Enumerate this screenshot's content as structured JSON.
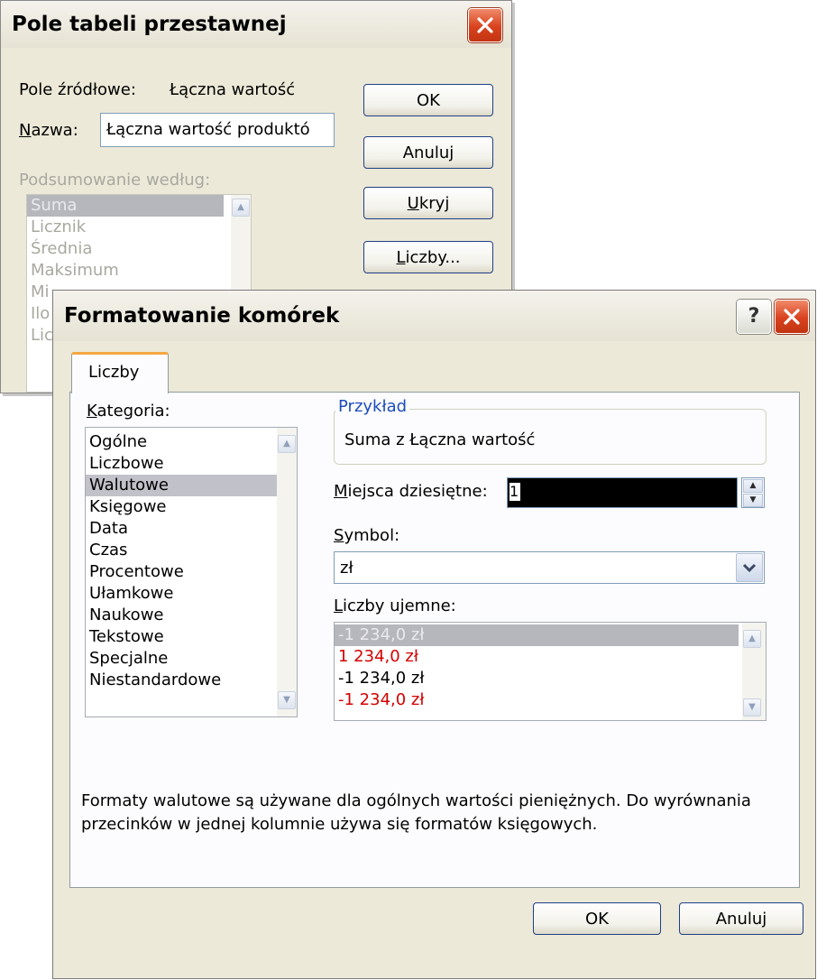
{
  "pivot_dialog": {
    "title": "Pole tabeli przestawnej",
    "source_field_label": "Pole źródłowe:",
    "source_field_value": "Łączna wartość",
    "name_label_u": "N",
    "name_label_rest": "azwa:",
    "name_value": "Łączna wartość produktó",
    "summary_label": "Podsumowanie według:",
    "summary_items": [
      "Suma",
      "Licznik",
      "Średnia",
      "Maksimum",
      "Mi",
      "Ilo",
      "Lic"
    ],
    "ok": "OK",
    "cancel": "Anuluj",
    "hide_u": "U",
    "hide_rest": "kryj",
    "numbers_u": "L",
    "numbers_rest": "iczby..."
  },
  "format_dialog": {
    "title": "Formatowanie komórek",
    "help_icon": "?",
    "tab": "Liczby",
    "category_label_u": "K",
    "category_label_rest": "ategoria:",
    "categories": [
      "Ogólne",
      "Liczbowe",
      "Walutowe",
      "Księgowe",
      "Data",
      "Czas",
      "Procentowe",
      "Ułamkowe",
      "Naukowe",
      "Tekstowe",
      "Specjalne",
      "Niestandardowe"
    ],
    "selected_category": "Walutowe",
    "sample_label": "Przykład",
    "sample_value": "Suma z Łączna wartość",
    "decimals_label_u": "M",
    "decimals_label_rest": "iejsca dziesiętne:",
    "decimals_value": "1",
    "symbol_label_u": "S",
    "symbol_label_rest": "ymbol:",
    "symbol_value": "zł",
    "negative_label_u": "L",
    "negative_label_rest": "iczby ujemne:",
    "negative_items": [
      {
        "text": "-1 234,0 zł",
        "style": "selected"
      },
      {
        "text": "1 234,0 zł",
        "style": "red"
      },
      {
        "text": "-1 234,0 zł",
        "style": "normal"
      },
      {
        "text": "-1 234,0 zł",
        "style": "red"
      }
    ],
    "description": "Formaty walutowe są używane dla ogólnych wartości pieniężnych. Do wyrównania przecinków w jednej kolumnie używa się formatów księgowych.",
    "ok": "OK",
    "cancel": "Anuluj"
  },
  "colors": {
    "negative_red": "#d40000",
    "accent_tab": "#f4a742",
    "button_border": "#1f3f85"
  }
}
